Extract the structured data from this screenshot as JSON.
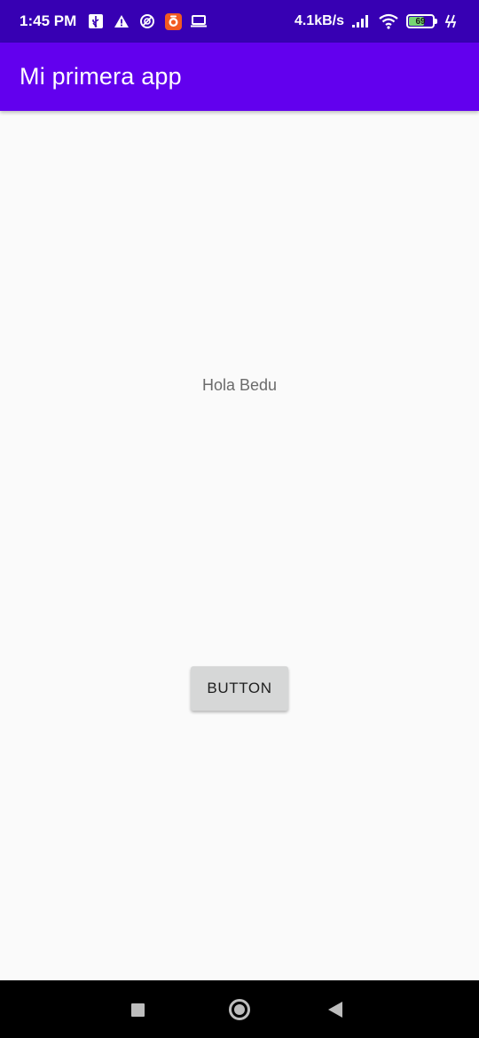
{
  "status_bar": {
    "time": "1:45 PM",
    "network_speed": "4.1kB/s",
    "battery_level": "69",
    "battery_fraction": 0.69,
    "icons": [
      "usb-icon",
      "warning-icon",
      "do-not-disturb-icon",
      "app-notification-icon",
      "laptop-icon",
      "signal-icon",
      "wifi-icon",
      "battery-icon",
      "charging-icon"
    ]
  },
  "app_bar": {
    "title": "Mi primera app",
    "color": "#6200ee"
  },
  "content": {
    "text": "Hola Bedu",
    "button_label": "BUTTON"
  },
  "nav_bar": {
    "buttons": [
      "recents-icon",
      "home-icon",
      "back-icon"
    ]
  },
  "colors": {
    "status_bar": "#3700b3",
    "app_bar": "#6200ee",
    "background": "#fafafa",
    "button": "#d6d7d7"
  }
}
